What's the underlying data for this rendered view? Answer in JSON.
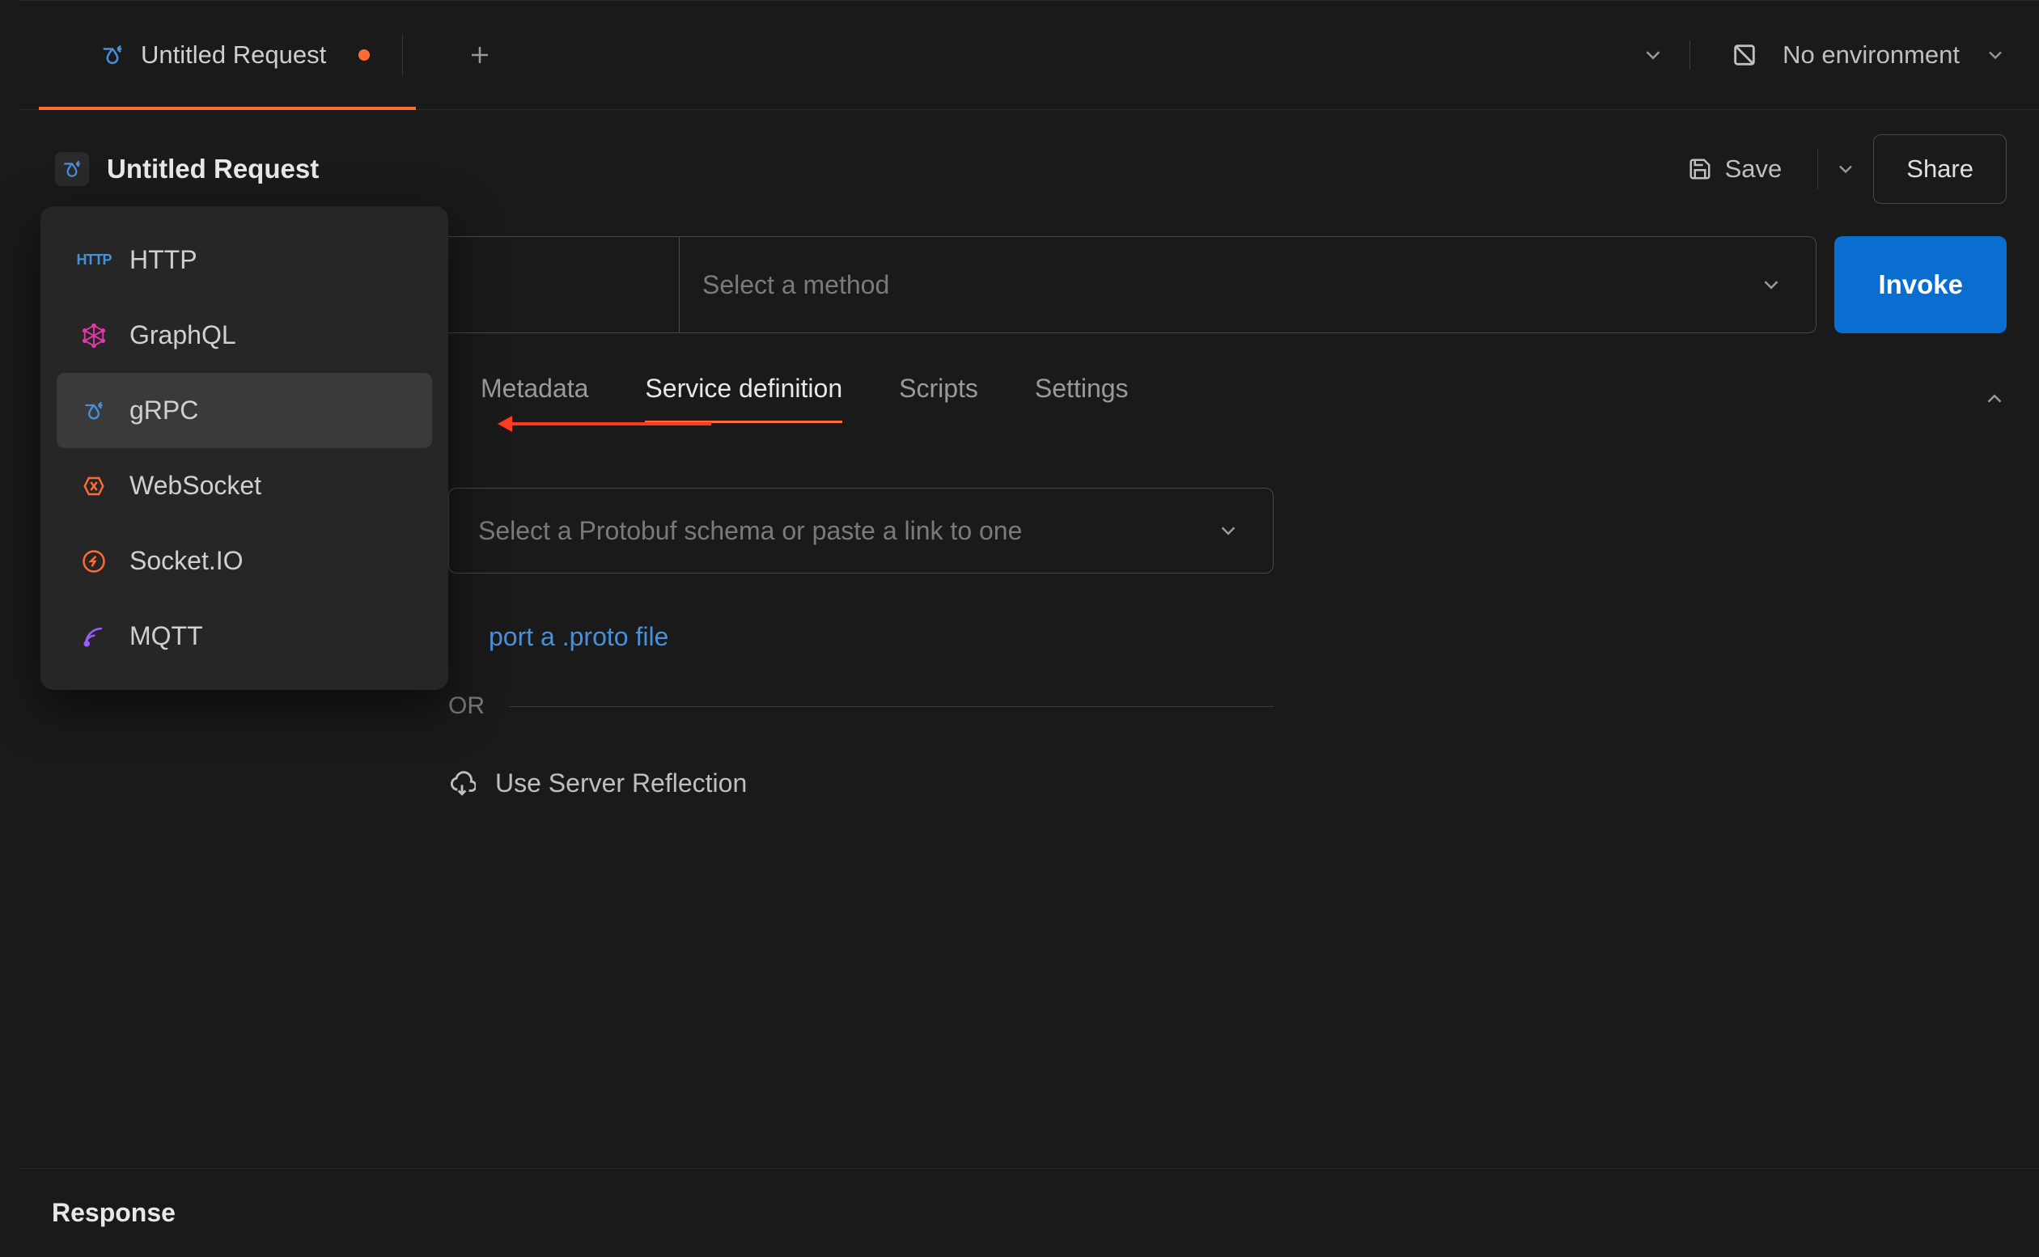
{
  "tab": {
    "label": "Untitled Request",
    "unsaved": true
  },
  "environment": {
    "label": "No environment"
  },
  "header": {
    "request_name": "Untitled Request",
    "save_label": "Save",
    "share_label": "Share"
  },
  "method_selector": {
    "placeholder": "Select a method"
  },
  "invoke_label": "Invoke",
  "request_tabs": {
    "items": [
      {
        "label": "Metadata"
      },
      {
        "label": "Service definition"
      },
      {
        "label": "Scripts"
      },
      {
        "label": "Settings"
      }
    ],
    "active_index": 1
  },
  "schema_input": {
    "placeholder": "Select a Protobuf schema or paste a link to one"
  },
  "import_link_text": "Import a .proto file",
  "import_link_visible_fragment": "port a .proto file",
  "or_label": "OR",
  "reflection_label": "Use Server Reflection",
  "response_label": "Response",
  "protocol_menu": {
    "items": [
      {
        "label": "HTTP",
        "icon": "http-icon"
      },
      {
        "label": "GraphQL",
        "icon": "graphql-icon"
      },
      {
        "label": "gRPC",
        "icon": "grpc-icon"
      },
      {
        "label": "WebSocket",
        "icon": "websocket-icon"
      },
      {
        "label": "Socket.IO",
        "icon": "socketio-icon"
      },
      {
        "label": "MQTT",
        "icon": "mqtt-icon"
      }
    ],
    "selected_index": 2
  }
}
